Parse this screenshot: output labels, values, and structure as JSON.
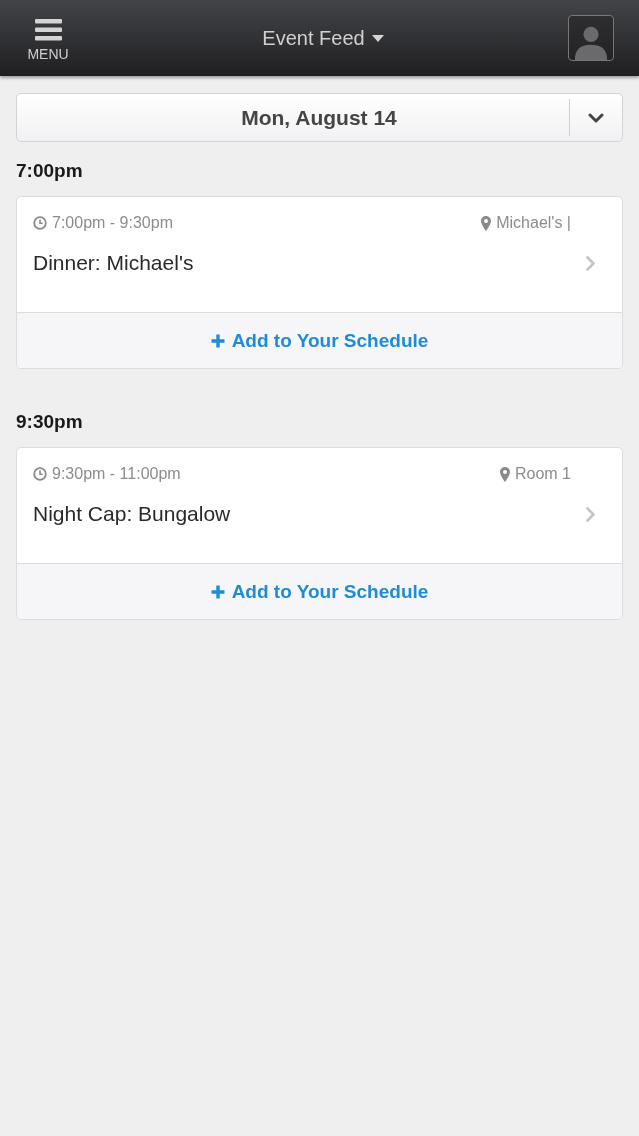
{
  "header": {
    "menu_label": "MENU",
    "title": "Event Feed"
  },
  "date_selector": {
    "value": "Mon, August 14"
  },
  "sections": [
    {
      "time": "7:00pm",
      "events": [
        {
          "time_range": "7:00pm - 9:30pm",
          "location": "Michael's |",
          "title": "Dinner: Michael's",
          "action": "Add to Your Schedule"
        }
      ]
    },
    {
      "time": "9:30pm",
      "events": [
        {
          "time_range": "9:30pm - 11:00pm",
          "location": "Room 1",
          "title": "Night Cap: Bungalow",
          "action": "Add to Your Schedule"
        }
      ]
    }
  ]
}
